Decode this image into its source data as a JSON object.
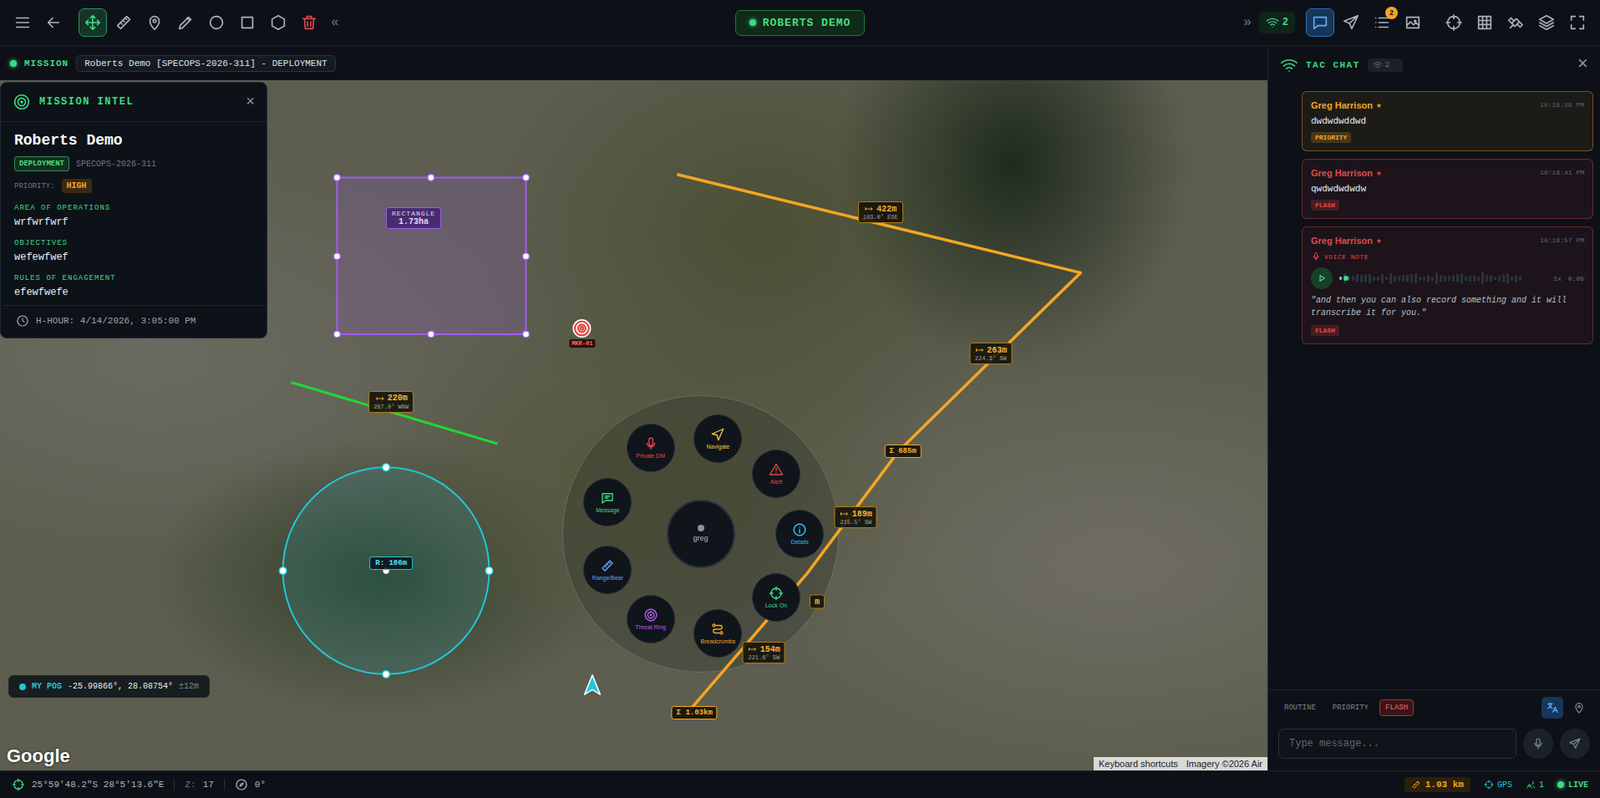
{
  "toolbar": {
    "left_tools": [
      {
        "kind": "menu",
        "selected": false
      },
      {
        "kind": "back",
        "selected": false
      },
      {
        "kind": "pan",
        "selected": true
      },
      {
        "kind": "measure",
        "selected": false
      },
      {
        "kind": "pin",
        "selected": false
      },
      {
        "kind": "draw",
        "selected": false
      },
      {
        "kind": "circle",
        "selected": false
      },
      {
        "kind": "rectangle",
        "selected": false
      },
      {
        "kind": "polygon",
        "selected": false
      },
      {
        "kind": "delete",
        "selected": false
      }
    ],
    "collapse": "«",
    "title": "ROBERTS DEMO",
    "expand": "»",
    "peers": "2",
    "right_tools": [
      {
        "kind": "chat",
        "selected": true,
        "badge": ""
      },
      {
        "kind": "send",
        "selected": false,
        "badge": ""
      },
      {
        "kind": "tasks",
        "selected": false,
        "badge": "2"
      },
      {
        "kind": "image",
        "selected": false,
        "badge": ""
      },
      {
        "kind": "crosshair",
        "selected": false,
        "badge": ""
      },
      {
        "kind": "grid",
        "selected": false,
        "badge": ""
      },
      {
        "kind": "satellite",
        "selected": false,
        "badge": ""
      },
      {
        "kind": "layers",
        "selected": false,
        "badge": ""
      },
      {
        "kind": "fullscreen",
        "selected": false,
        "badge": ""
      }
    ]
  },
  "mission_bar": {
    "label": "MISSION",
    "value": "Roberts Demo [SPECOPS-2026-311] - DEPLOYMENT"
  },
  "intel": {
    "title": "MISSION INTEL",
    "close": "×",
    "name": "Roberts Demo",
    "phase": "DEPLOYMENT",
    "code": "SPECOPS-2026-311",
    "priority_label": "PRIORITY:",
    "priority": "HIGH",
    "sections": [
      {
        "label": "AREA OF OPERATIONS",
        "value": "wrfwrfwrf"
      },
      {
        "label": "OBJECTIVES",
        "value": "wefewfwef"
      },
      {
        "label": "RULES OF ENGAGEMENT",
        "value": "efewfwefe"
      }
    ],
    "h_hour": "H-HOUR: 4/14/2026, 3:05:00 PM"
  },
  "map": {
    "rectangle": {
      "label": "RECTANGLE",
      "area": "1.73ha",
      "color": "#a35cf0"
    },
    "circle": {
      "label": "R: 106m",
      "color": "#22c5d8"
    },
    "line": {
      "distance": "220m",
      "bearing": "287.0° WNW",
      "color": "#22d633"
    },
    "route": {
      "color": "#f5a623",
      "segments": [
        {
          "distance": "422m",
          "bearing": "103.0° ESE"
        },
        {
          "distance": "263m",
          "bearing": "224.3° SW"
        },
        {
          "distance": "189m",
          "bearing": "215.5° SW"
        },
        {
          "distance": "m",
          "bearing": ""
        },
        {
          "distance": "154m",
          "bearing": "221.6° SW"
        }
      ],
      "totals": [
        "Σ 685m",
        "Σ 1.03km"
      ]
    },
    "marker": {
      "label": "MKR-01"
    },
    "radial_menu": {
      "center": "greg",
      "items": [
        {
          "kind": "mic",
          "label": "Private DM",
          "color": "#e04848"
        },
        {
          "kind": "navigate",
          "label": "Navigate",
          "color": "#f5c542"
        },
        {
          "kind": "alert",
          "label": "Alert",
          "color": "#e04848"
        },
        {
          "kind": "message",
          "label": "Message",
          "color": "#3ddc84"
        },
        {
          "kind": "details",
          "label": "Details",
          "color": "#38bdf8"
        },
        {
          "kind": "range",
          "label": "Range/Bear",
          "color": "#60a5fa"
        },
        {
          "kind": "lockon",
          "label": "Lock On",
          "color": "#3ddc84"
        },
        {
          "kind": "threat",
          "label": "Threat Ring",
          "color": "#b15cf0"
        },
        {
          "kind": "breadcrumbs",
          "label": "Breadcrumbs",
          "color": "#f5a623"
        }
      ]
    },
    "my_pos": {
      "label": "MY POS",
      "value": "-25.99866°, 28.08754°",
      "accuracy": "±12m"
    },
    "attribution": {
      "logo": "Google",
      "shortcuts": "Keyboard shortcuts",
      "imagery": "Imagery ©2026 Air"
    }
  },
  "chat": {
    "title": "TAC CHAT",
    "peers": "2",
    "close": "×",
    "messages": [
      {
        "kind": "text",
        "author": "Greg Harrison",
        "star": "★",
        "time": "10:18:28 PM",
        "text": "dwdwdwddwd",
        "tag": "PRIORITY",
        "color": "#f5a623"
      },
      {
        "kind": "text",
        "author": "Greg Harrison",
        "star": "★",
        "time": "10:18:41 PM",
        "text": "qwdwdwdwdw",
        "tag": "FLASH",
        "color": "#e04848"
      },
      {
        "kind": "voice",
        "author": "Greg Harrison",
        "star": "★",
        "time": "10:18:57 PM",
        "voice_label": "VOICE NOTE",
        "level": 0.02,
        "speed": "1x",
        "duration": "0:05",
        "text": "\"and then you can also record something and it will transcribe it for you.\"",
        "tag": "FLASH",
        "color": "#e04848"
      }
    ],
    "priorities": [
      {
        "label": "ROUTINE",
        "selected": false
      },
      {
        "label": "PRIORITY",
        "selected": false
      },
      {
        "label": "FLASH",
        "selected": true
      }
    ],
    "placeholder": "Type message..."
  },
  "status_bar": {
    "coords": "25°59'48.2\"S 28°5'13.6\"E",
    "zoom_label": "Z:",
    "zoom": "17",
    "heading": "0°",
    "distance": "1.03 km",
    "gps": "GPS",
    "users": "1",
    "live": "LIVE"
  }
}
